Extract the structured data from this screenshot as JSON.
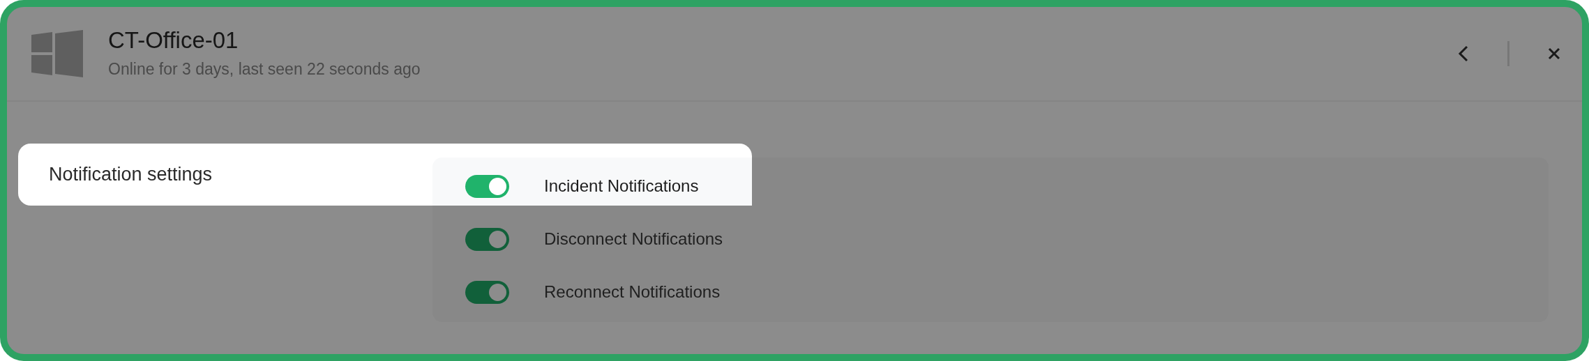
{
  "header": {
    "title": "CT-Office-01",
    "subtitle": "Online for 3 days, last seen 22 seconds ago"
  },
  "section": {
    "title": "Notification settings",
    "highlighted": true
  },
  "notifications": [
    {
      "label": "Incident Notifications",
      "on": true,
      "highlighted": true
    },
    {
      "label": "Disconnect Notifications",
      "on": true,
      "highlighted": false
    },
    {
      "label": "Reconnect Notifications",
      "on": true,
      "highlighted": false
    }
  ]
}
